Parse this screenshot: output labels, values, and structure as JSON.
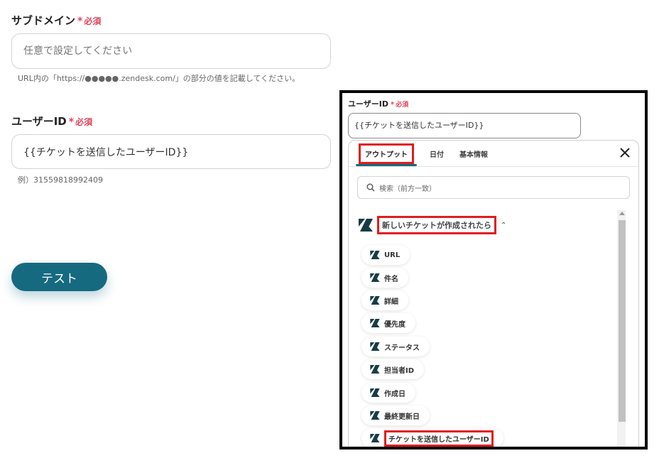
{
  "subdomain": {
    "label": "サブドメイン",
    "required_mark": "*",
    "required_text": "必須",
    "placeholder": "任意で設定してください",
    "hint": "URL内の「https://●●●●●.zendesk.com/」の部分の値を記載してください。"
  },
  "user_id": {
    "label": "ユーザーID",
    "required_mark": "*",
    "required_text": "必須",
    "value": "{{チケットを送信したユーザーID}}",
    "hint": "例）31559818992409"
  },
  "test_button": "テスト",
  "panel": {
    "label": "ユーザーID",
    "required_mark": "*",
    "required_text": "必須",
    "input_value": "{{チケットを送信したユーザーID}}",
    "tabs": [
      "アウトプット",
      "日付",
      "基本情報"
    ],
    "search_placeholder": "検索（前方一致）",
    "group_title": "新しいチケットが作成されたら",
    "items": [
      "URL",
      "件名",
      "詳細",
      "優先度",
      "ステータス",
      "担当者ID",
      "作成日",
      "最終更新日",
      "チケットを送信したユーザーID"
    ],
    "icon": "zendesk-icon",
    "colors": {
      "accent": "#156a80",
      "required": "#e0445b",
      "highlight": "#e11d1d"
    }
  }
}
